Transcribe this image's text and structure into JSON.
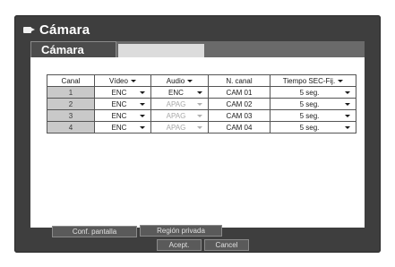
{
  "window": {
    "title": "Cámara",
    "icon": "camera-icon"
  },
  "tabs": [
    {
      "label": "Cámara",
      "active": true
    },
    {
      "label": "",
      "active": false
    }
  ],
  "table": {
    "headers": [
      "Canal",
      "Vídeo",
      "Audio",
      "N. canal",
      "Tiempo SEC-Fij."
    ],
    "rows": [
      {
        "canal": "1",
        "video": "ENC",
        "audio": "ENC",
        "audio_enabled": true,
        "nombre": "CAM 01",
        "tiempo": "5 seg."
      },
      {
        "canal": "2",
        "video": "ENC",
        "audio": "APAG",
        "audio_enabled": false,
        "nombre": "CAM 02",
        "tiempo": "5 seg."
      },
      {
        "canal": "3",
        "video": "ENC",
        "audio": "APAG",
        "audio_enabled": false,
        "nombre": "CAM 03",
        "tiempo": "5 seg."
      },
      {
        "canal": "4",
        "video": "ENC",
        "audio": "APAG",
        "audio_enabled": false,
        "nombre": "CAM 04",
        "tiempo": "5 seg."
      }
    ]
  },
  "buttons": {
    "conf_pantalla": "Conf. pantalla",
    "region_privada": "Región privada",
    "acept": "Acept.",
    "cancel": "Cancel"
  },
  "colors": {
    "window_bg": "#3e3e3e",
    "tab_bar": "#6a6a6a",
    "panel_bg": "#ffffff",
    "canal_cell": "#c9c9c9",
    "disabled_text": "#a8a8a8"
  }
}
